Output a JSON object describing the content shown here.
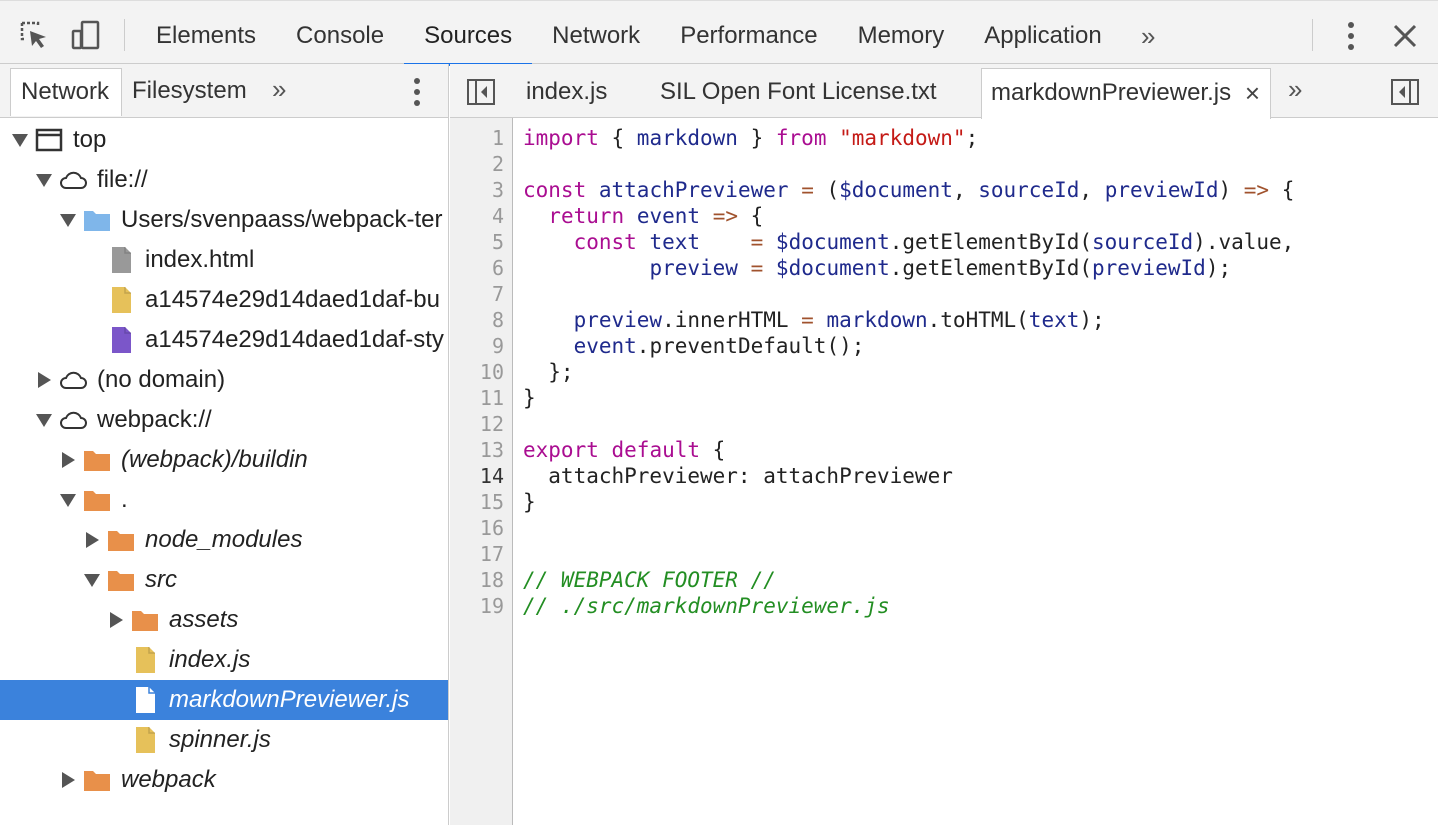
{
  "toolbar": {
    "tabs": [
      "Elements",
      "Console",
      "Sources",
      "Network",
      "Performance",
      "Memory",
      "Application"
    ],
    "active_tab": "Sources",
    "more": "»"
  },
  "navigator": {
    "tabs": [
      "Network",
      "Filesystem"
    ],
    "more": "»",
    "tree": [
      {
        "label": "top",
        "type": "frame",
        "expanded": true
      },
      {
        "label": "file://",
        "type": "cloud",
        "expanded": true
      },
      {
        "label": "Users/svenpaass/webpack-ter",
        "type": "folder-blue",
        "expanded": true
      },
      {
        "label": "index.html",
        "type": "file-gray"
      },
      {
        "label": "a14574e29d14daed1daf-bu",
        "type": "file-yellow"
      },
      {
        "label": "a14574e29d14daed1daf-sty",
        "type": "file-purple"
      },
      {
        "label": "(no domain)",
        "type": "cloud",
        "expanded": false
      },
      {
        "label": "webpack://",
        "type": "cloud",
        "expanded": true
      },
      {
        "label": "(webpack)/buildin",
        "type": "folder-orange",
        "expanded": false
      },
      {
        "label": ".",
        "type": "folder-orange",
        "expanded": true
      },
      {
        "label": "node_modules",
        "type": "folder-orange",
        "expanded": false
      },
      {
        "label": "src",
        "type": "folder-orange",
        "expanded": true
      },
      {
        "label": "assets",
        "type": "folder-orange",
        "expanded": false
      },
      {
        "label": "index.js",
        "type": "file-yellow"
      },
      {
        "label": "markdownPreviewer.js",
        "type": "file-white",
        "selected": true
      },
      {
        "label": "spinner.js",
        "type": "file-yellow"
      },
      {
        "label": "webpack",
        "type": "folder-orange",
        "expanded": false
      }
    ]
  },
  "editor": {
    "tabs": [
      "index.js",
      "SIL Open Font License.txt",
      "markdownPreviewer.js"
    ],
    "active_tab": "markdownPreviewer.js",
    "close_glyph": "×",
    "more": "»",
    "current_line": 14,
    "line_numbers": [
      "1",
      "2",
      "3",
      "4",
      "5",
      "6",
      "7",
      "8",
      "9",
      "10",
      "11",
      "12",
      "13",
      "14",
      "15",
      "16",
      "17",
      "18",
      "19"
    ],
    "code_lines": [
      "import { markdown } from \"markdown\";",
      "",
      "const attachPreviewer = ($document, sourceId, previewId) => {",
      "  return event => {",
      "    const text    = $document.getElementById(sourceId).value,",
      "          preview = $document.getElementById(previewId);",
      "",
      "    preview.innerHTML = markdown.toHTML(text);",
      "    event.preventDefault();",
      "  };",
      "}",
      "",
      "export default {",
      "  attachPreviewer: attachPreviewer",
      "}",
      "",
      "",
      "// WEBPACK FOOTER //",
      "// ./src/markdownPreviewer.js"
    ]
  },
  "colors": {
    "accent": "#1a73e8",
    "selection": "#3b82dc",
    "keyword": "#aa0d91",
    "variable": "#1f2a8c",
    "string": "#c41a16",
    "comment": "#238e23",
    "folder_orange": "#e8904a",
    "folder_blue": "#7fb6ea"
  }
}
